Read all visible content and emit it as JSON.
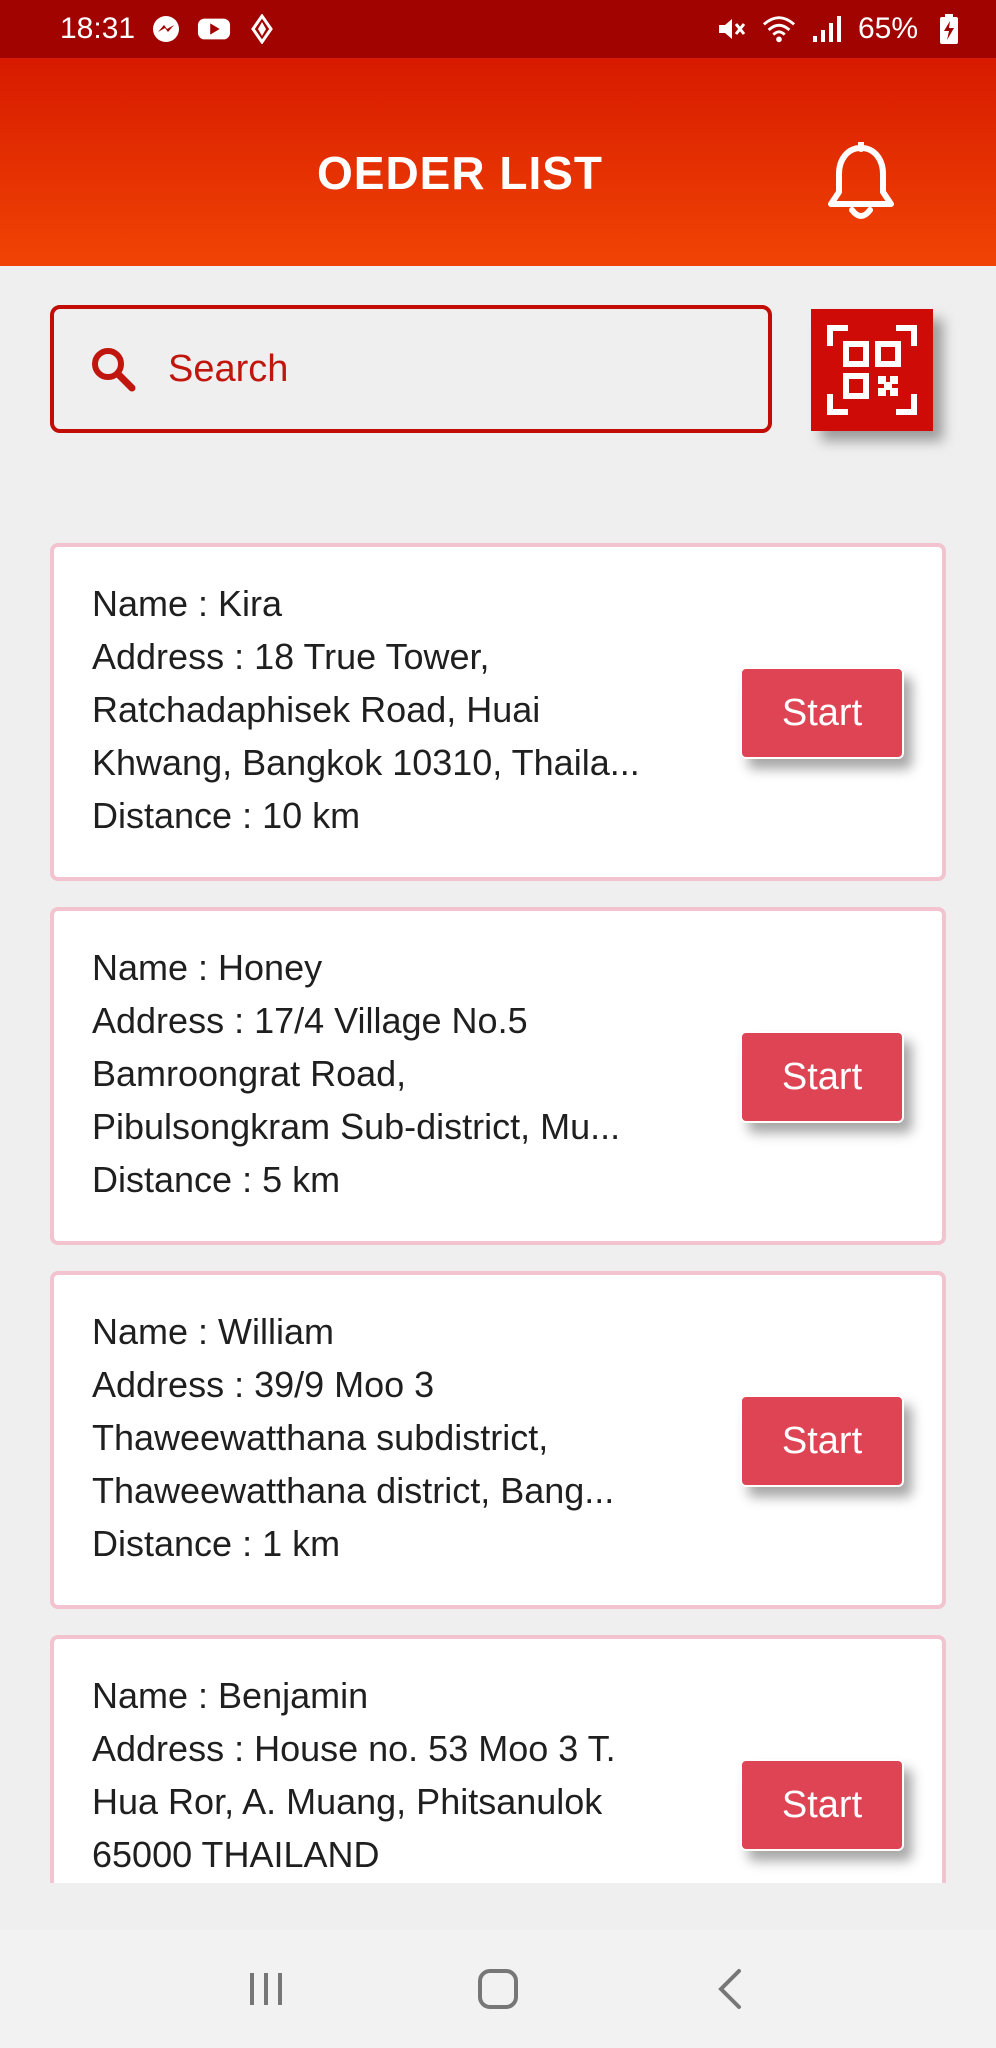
{
  "status_bar": {
    "time": "18:31",
    "battery": "65%",
    "icons": [
      "messenger-icon",
      "youtube-icon",
      "diamond-icon",
      "mute-icon",
      "wifi-icon",
      "signal-icon",
      "battery-charging-icon"
    ]
  },
  "header": {
    "title": "OEDER LIST",
    "bell_icon": "bell-icon"
  },
  "search": {
    "placeholder": "Search",
    "value": "",
    "icon": "search-icon"
  },
  "qr": {
    "icon": "qr-code-icon"
  },
  "orders": [
    {
      "name": "Name : Kira",
      "address_lines": [
        "Address : 18 True Tower,",
        "Ratchadaphisek Road, Huai",
        "Khwang, Bangkok 10310, Thaila..."
      ],
      "distance": "Distance : 10 km",
      "button": "Start"
    },
    {
      "name": "Name : Honey",
      "address_lines": [
        "Address : 17/4 Village No.5",
        "Bamroongrat Road,",
        "Pibulsongkram Sub-district, Mu..."
      ],
      "distance": "Distance : 5 km",
      "button": "Start"
    },
    {
      "name": "Name : William",
      "address_lines": [
        "Address : 39/9 Moo 3",
        "Thaweewatthana subdistrict,",
        "Thaweewatthana district, Bang..."
      ],
      "distance": "Distance : 1 km",
      "button": "Start"
    },
    {
      "name": "Name : Benjamin",
      "address_lines": [
        "Address : House no. 53 Moo 3 T.",
        "Hua Ror, A. Muang, Phitsanulok",
        "65000 THAILAND"
      ],
      "distance": "",
      "button": "Start"
    }
  ],
  "colors": {
    "status_bar": "#a10300",
    "header_top": "#d71a00",
    "header_bottom": "#f14404",
    "accent": "#c10d05",
    "start_button": "#df4454",
    "card_border": "#f3c3cf"
  },
  "nav": [
    "recent-apps-icon",
    "home-icon",
    "back-icon"
  ]
}
